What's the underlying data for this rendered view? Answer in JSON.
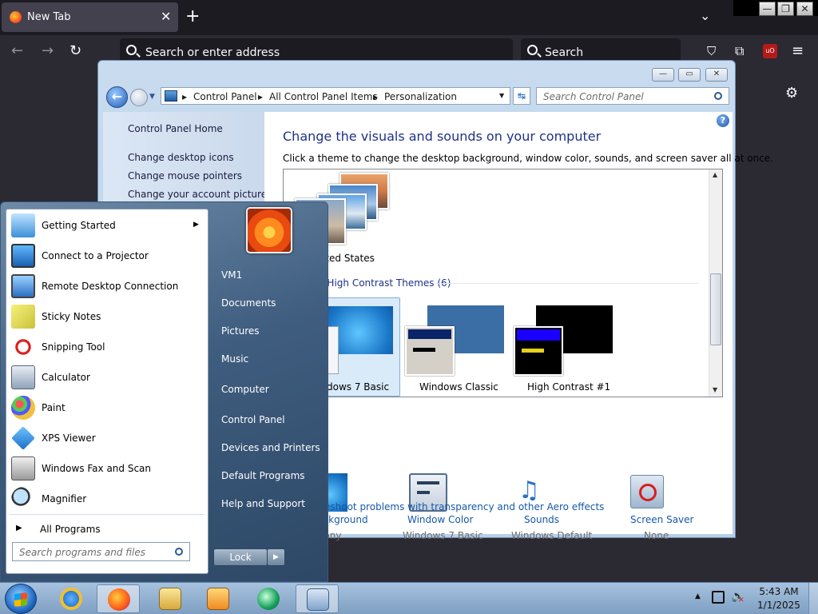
{
  "browser": {
    "tab_title": "New Tab",
    "tab_close": "✕",
    "new_tab": "+",
    "list_all_tabs": "⌄",
    "url_placeholder": "Search or enter address",
    "search_placeholder": "Search"
  },
  "control_panel": {
    "breadcrumb": [
      "Control Panel",
      "All Control Panel Items",
      "Personalization"
    ],
    "search_placeholder": "Search Control Panel",
    "sidebar": [
      "Control Panel Home",
      "Change desktop icons",
      "Change mouse pointers",
      "Change your account picture"
    ],
    "heading": "Change the visuals and sounds on your computer",
    "subtitle": "Click a theme to change the desktop background, window color, sounds, and screen saver all at once.",
    "help": "?",
    "theme_top_label": "ited States",
    "theme_group_header": "d High Contrast Themes (6)",
    "themes": [
      "dows 7 Basic",
      "Windows Classic",
      "High Contrast #1"
    ],
    "bottom": [
      {
        "link": "Background",
        "value": "rmony"
      },
      {
        "link": "Window Color",
        "value": "Windows 7 Basic"
      },
      {
        "link": "Sounds",
        "value": "Windows Default"
      },
      {
        "link": "Screen Saver",
        "value": "None"
      }
    ],
    "aero_link": "eshoot problems with transparency and other Aero effects"
  },
  "start_menu": {
    "programs": [
      "Getting Started",
      "Connect to a Projector",
      "Remote Desktop Connection",
      "Sticky Notes",
      "Snipping Tool",
      "Calculator",
      "Paint",
      "XPS Viewer",
      "Windows Fax and Scan",
      "Magnifier"
    ],
    "all_programs": "All Programs",
    "search_placeholder": "Search programs and files",
    "right": [
      "VM1",
      "Documents",
      "Pictures",
      "Music",
      "Computer",
      "Control Panel",
      "Devices and Printers",
      "Default Programs",
      "Help and Support"
    ],
    "lock": "Lock"
  },
  "taskbar": {
    "time": "5:43 AM",
    "date": "1/1/2025"
  },
  "colors": {
    "link": "#1659a8",
    "heading": "#1e3287",
    "taskbar": "#7e9fc2"
  }
}
